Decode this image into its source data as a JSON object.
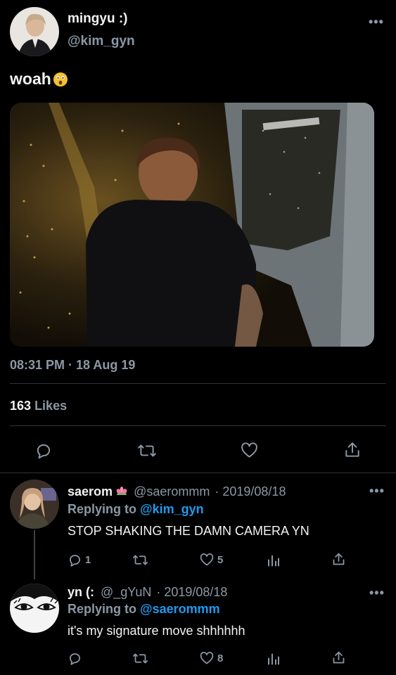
{
  "main_tweet": {
    "display_name": "mingyu :)",
    "handle": "@kim_gyn",
    "text": "woah",
    "emoji": "astonished-face-emoji",
    "timestamp": "08:31 PM · 18 Aug 19",
    "likes_count": "163",
    "likes_label": "Likes"
  },
  "replies": [
    {
      "display_name": "saerom",
      "name_emoji": "lotus-emoji",
      "handle": "@saerommm",
      "date": "· 2019/08/18",
      "replying_prefix": "Replying to",
      "replying_to": "@kim_gyn",
      "text": "STOP SHAKING THE DAMN CAMERA YN",
      "reply_count": "1",
      "retweet_count": "",
      "like_count": "5"
    },
    {
      "display_name": "yn (:",
      "handle": "@_gYuN",
      "date": "· 2019/08/18",
      "replying_prefix": "Replying to",
      "replying_to": "@saerommm",
      "text": "it's my signature move shhhhhh",
      "reply_count": "",
      "retweet_count": "",
      "like_count": "8"
    }
  ],
  "colors": {
    "background": "#000000",
    "text_primary": "#f2f3f4",
    "text_secondary": "#8b98a5",
    "link_blue": "#1d9bf0",
    "divider": "#2f3336"
  }
}
